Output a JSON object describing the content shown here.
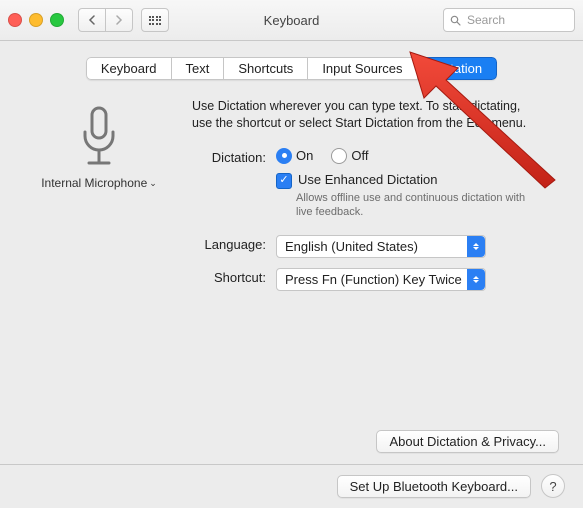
{
  "window": {
    "title": "Keyboard"
  },
  "search": {
    "placeholder": "Search"
  },
  "tabs": [
    "Keyboard",
    "Text",
    "Shortcuts",
    "Input Sources",
    "Dictation"
  ],
  "active_tab_index": 4,
  "microphone": {
    "label": "Internal Microphone"
  },
  "intro": {
    "line1": "Use Dictation wherever you can type text. To start dictating,",
    "line2": "use the shortcut or select Start Dictation from the Edit menu."
  },
  "dictation": {
    "label": "Dictation:",
    "on": "On",
    "off": "Off",
    "selected": "on",
    "enhanced_label": "Use Enhanced Dictation",
    "enhanced_checked": true,
    "enhanced_note": "Allows offline use and continuous dictation with live feedback."
  },
  "language": {
    "label": "Language:",
    "value": "English (United States)"
  },
  "shortcut": {
    "label": "Shortcut:",
    "value": "Press Fn (Function) Key Twice"
  },
  "buttons": {
    "about": "About Dictation & Privacy...",
    "bluetooth": "Set Up Bluetooth Keyboard...",
    "help": "?"
  },
  "annotation": {
    "type": "arrow",
    "color": "#ef3a2d",
    "target": "tab-dictation"
  }
}
